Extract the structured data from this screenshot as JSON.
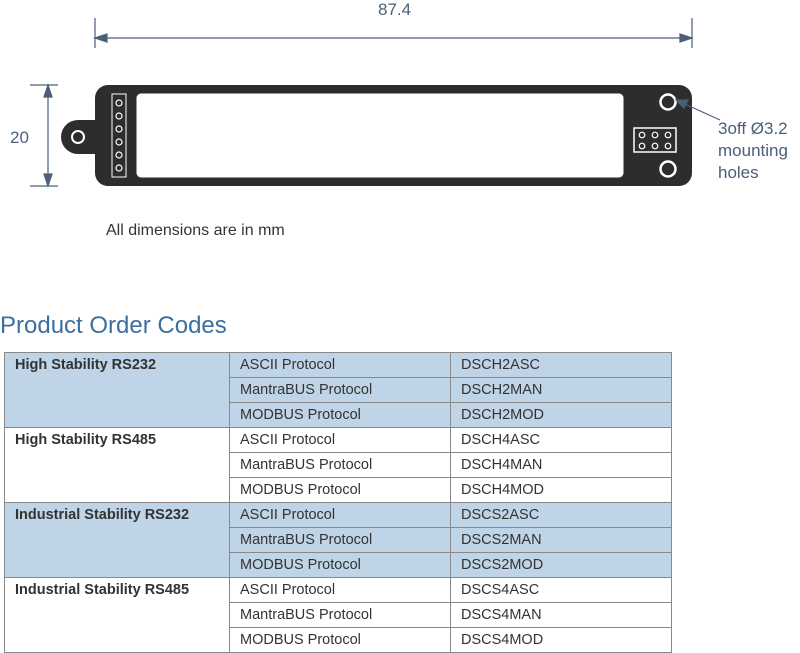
{
  "diagram": {
    "width_dim": "87.4",
    "height_dim": "20",
    "callout": "3off Ø3.2\nmounting\nholes",
    "caption": "All dimensions are in mm"
  },
  "section_title": "Product Order Codes",
  "table": {
    "groups": [
      {
        "name": "High Stability RS232",
        "blue": true,
        "rows": [
          {
            "protocol": "ASCII Protocol",
            "code": "DSCH2ASC"
          },
          {
            "protocol": "MantraBUS Protocol",
            "code": "DSCH2MAN"
          },
          {
            "protocol": "MODBUS Protocol",
            "code": "DSCH2MOD"
          }
        ]
      },
      {
        "name": "High Stability RS485",
        "blue": false,
        "rows": [
          {
            "protocol": "ASCII Protocol",
            "code": "DSCH4ASC"
          },
          {
            "protocol": "MantraBUS Protocol",
            "code": "DSCH4MAN"
          },
          {
            "protocol": "MODBUS Protocol",
            "code": "DSCH4MOD"
          }
        ]
      },
      {
        "name": "Industrial Stability RS232",
        "blue": true,
        "rows": [
          {
            "protocol": "ASCII Protocol",
            "code": "DSCS2ASC"
          },
          {
            "protocol": "MantraBUS Protocol",
            "code": "DSCS2MAN"
          },
          {
            "protocol": "MODBUS Protocol",
            "code": "DSCS2MOD"
          }
        ]
      },
      {
        "name": "Industrial Stability RS485",
        "blue": false,
        "rows": [
          {
            "protocol": "ASCII Protocol",
            "code": "DSCS4ASC"
          },
          {
            "protocol": "MantraBUS Protocol",
            "code": "DSCS4MAN"
          },
          {
            "protocol": "MODBUS Protocol",
            "code": "DSCS4MOD"
          }
        ]
      }
    ]
  }
}
